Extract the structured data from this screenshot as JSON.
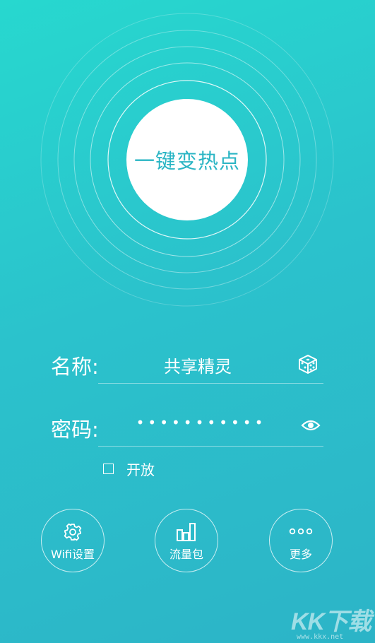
{
  "hotspot": {
    "button_label": "一键变热点"
  },
  "form": {
    "name_label": "名称:",
    "name_value": "共享精灵",
    "password_label": "密码:",
    "password_masked": "•••••••••••",
    "open_label": "开放",
    "open_checked": false
  },
  "actions": [
    {
      "label": "Wifi设置",
      "icon": "gear-icon"
    },
    {
      "label": "流量包",
      "icon": "bar-chart-icon"
    },
    {
      "label": "更多",
      "icon": "more-dots-icon"
    }
  ],
  "watermark": {
    "text": "KK下载",
    "sub": "www.kkx.net"
  },
  "colors": {
    "bg_top": "#27d8cf",
    "bg_bottom": "#2cb4c7",
    "accent": "#2ab5c4"
  }
}
